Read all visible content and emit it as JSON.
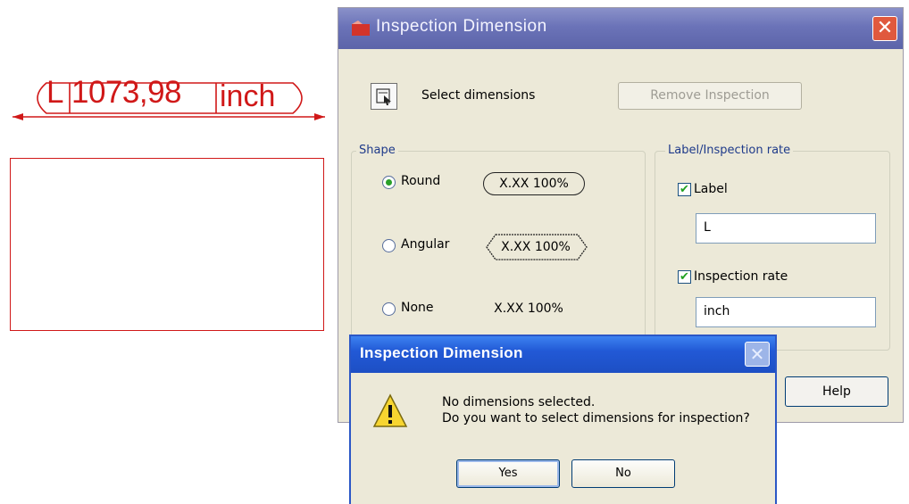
{
  "cad": {
    "label_prefix": "L",
    "value": "1073,98",
    "unit": "inch",
    "color": "#d01818"
  },
  "main_dialog": {
    "title": "Inspection Dimension",
    "close_symbol": "✕",
    "select_label": "Select dimensions",
    "remove_button": "Remove Inspection",
    "shape_group": {
      "legend": "Shape",
      "options": [
        {
          "label": "Round",
          "sample": "X.XX 100%",
          "selected": true
        },
        {
          "label": "Angular",
          "sample": "X.XX 100%",
          "selected": false
        },
        {
          "label": "None",
          "sample": "X.XX 100%",
          "selected": false
        }
      ]
    },
    "label_group": {
      "legend": "Label/Inspection rate",
      "label_checkbox": "Label",
      "label_checked": true,
      "label_value": "L",
      "rate_checkbox": "Inspection rate",
      "rate_checked": true,
      "rate_value": "inch"
    },
    "help_button": "Help"
  },
  "message_box": {
    "title": "Inspection Dimension",
    "close_symbol": "✕",
    "line1": "No dimensions selected.",
    "line2": "Do you want to select dimensions for inspection?",
    "yes_button": "Yes",
    "no_button": "No",
    "icons": {
      "warning": "warning-icon"
    }
  }
}
